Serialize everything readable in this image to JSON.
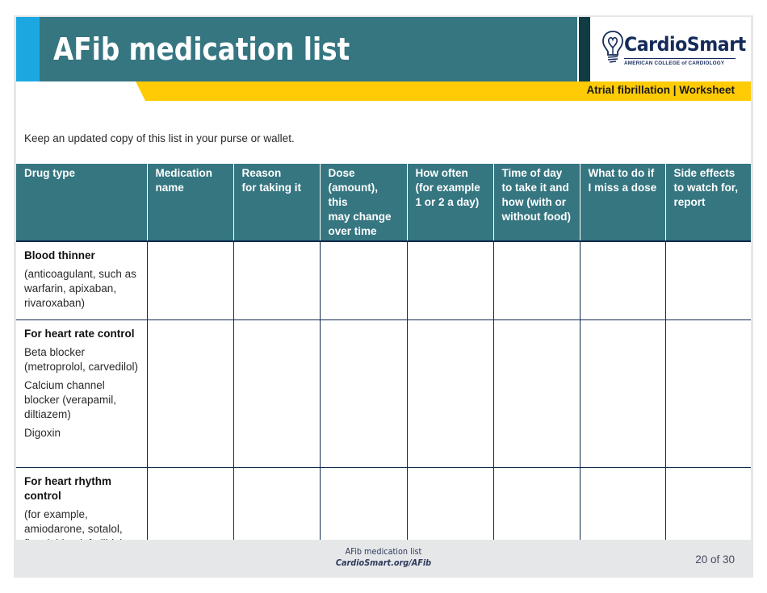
{
  "header": {
    "title": "AFib medication list",
    "subtitle": "Atrial fibrillation | Worksheet",
    "logo": {
      "icon": "lightbulb-heart-icon",
      "name": "CardioSmart",
      "org": "AMERICAN COLLEGE of CARDIOLOGY"
    }
  },
  "colors": {
    "teal": "#357681",
    "accent_blue": "#1ba8e0",
    "dark_teal": "#123c43",
    "yellow": "#fecb05",
    "navy": "#142b5a",
    "footer_gray": "#e6e7e9"
  },
  "intro": "Keep an updated copy of this list in your purse or wallet.",
  "table": {
    "columns": [
      "Drug type",
      "Medication name",
      "Reason for taking it",
      "Dose (amount), this may change over time",
      "How often (for example 1 or 2 a day)",
      "Time of day to take it and how (with or without food)",
      "What to do if I miss a dose",
      "Side effects to watch for, report"
    ],
    "column_lines": [
      [
        "Drug type"
      ],
      [
        "Medication",
        "name"
      ],
      [
        "Reason",
        "for taking it"
      ],
      [
        "Dose",
        "(amount), this",
        "may change",
        "over time"
      ],
      [
        "How often",
        "(for example",
        "1 or 2 a day)"
      ],
      [
        "Time of day",
        "to take it and",
        "how (with or",
        "without food)"
      ],
      [
        "What to do if",
        "I miss a dose"
      ],
      [
        "Side effects",
        "to watch for,",
        "report"
      ]
    ],
    "rows": [
      {
        "category": "Blood thinner",
        "details": [
          "(anticoagulant, such as warfarin, apixaban, rivaroxaban)"
        ],
        "cells": [
          "",
          "",
          "",
          "",
          "",
          "",
          ""
        ]
      },
      {
        "category": "For heart rate control",
        "details": [
          "Beta blocker (metroprolol, carvedilol)",
          "Calcium channel blocker (verapamil, diltiazem)",
          "Digoxin"
        ],
        "cells": [
          "",
          "",
          "",
          "",
          "",
          "",
          ""
        ]
      },
      {
        "category": "For heart rhythm control",
        "details": [
          "(for example, amiodarone, sotalol, flecainide, dofetilide)"
        ],
        "cells": [
          "",
          "",
          "",
          "",
          "",
          "",
          ""
        ]
      }
    ]
  },
  "footer": {
    "doc_title": "AFib medication list",
    "url": "CardioSmart.org/AFib",
    "page": "20 of 30"
  }
}
